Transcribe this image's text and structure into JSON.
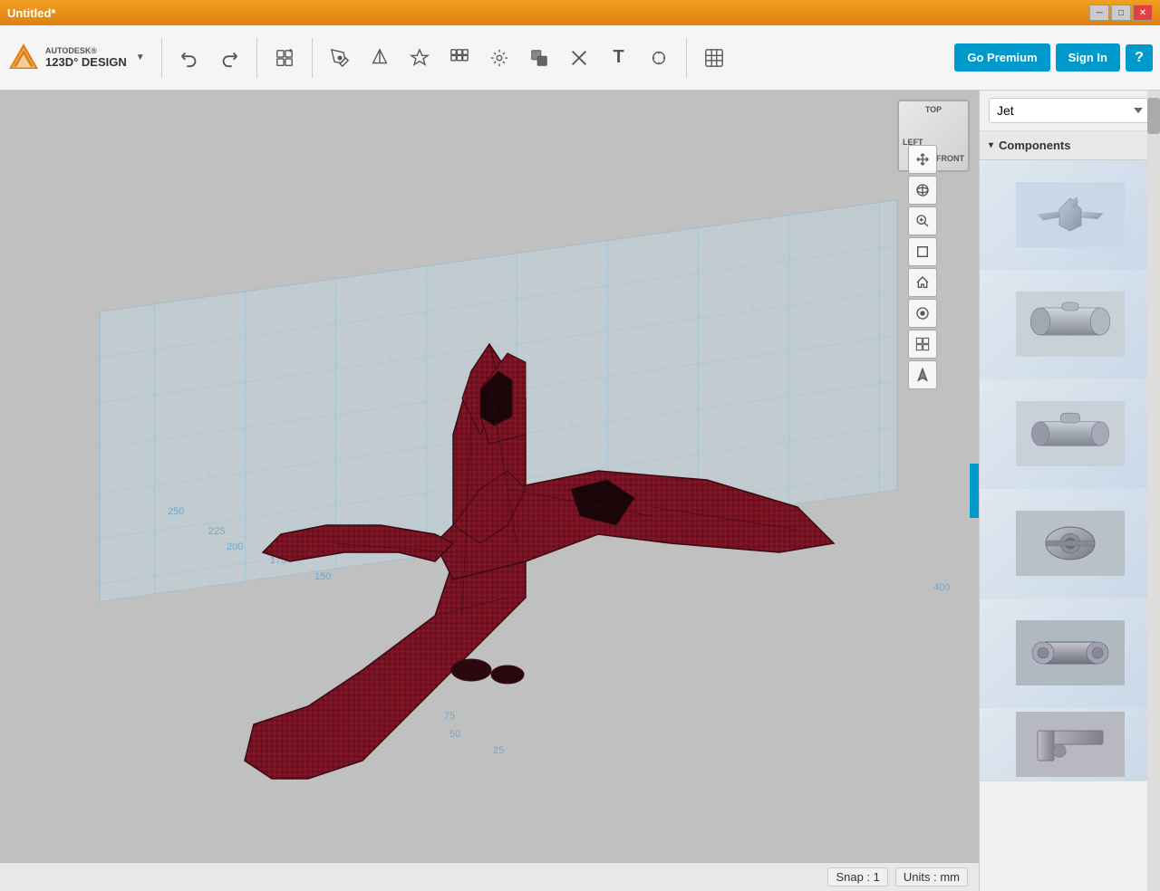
{
  "titleBar": {
    "title": "Untitled*",
    "controls": {
      "minimize": "─",
      "maximize": "□",
      "close": "✕"
    }
  },
  "toolbar": {
    "logo": {
      "autodesk": "AUTODESK®",
      "product": "123D° DESIGN",
      "dropdownLabel": "▼"
    },
    "tools": [
      {
        "name": "undo",
        "label": "↩",
        "title": "Undo"
      },
      {
        "name": "redo",
        "label": "↪",
        "title": "Redo"
      },
      {
        "name": "new-shape",
        "label": "⊞",
        "title": "New Shape"
      },
      {
        "name": "sketch",
        "label": "✎",
        "title": "Sketch"
      },
      {
        "name": "construct",
        "label": "⬡",
        "title": "Construct"
      },
      {
        "name": "modify",
        "label": "⟳",
        "title": "Modify"
      },
      {
        "name": "pattern",
        "label": "⊞",
        "title": "Pattern"
      },
      {
        "name": "transform",
        "label": "↻",
        "title": "Transform"
      },
      {
        "name": "combine",
        "label": "⬛",
        "title": "Combine"
      },
      {
        "name": "delete",
        "label": "✕",
        "title": "Delete"
      },
      {
        "name": "text",
        "label": "T",
        "title": "Text"
      },
      {
        "name": "measure",
        "label": "◯",
        "title": "Measure"
      },
      {
        "name": "snap-grid",
        "label": "⊞",
        "title": "Snap/Grid"
      }
    ],
    "rightButtons": {
      "premium": "Go Premium",
      "signin": "Sign In",
      "help": "?"
    }
  },
  "viewport": {
    "navCube": {
      "top": "TOP",
      "left": "LEFT",
      "front": "FRONT"
    },
    "viewControls": [
      {
        "name": "pan",
        "icon": "+",
        "title": "Pan"
      },
      {
        "name": "orbit",
        "icon": "↻",
        "title": "Orbit"
      },
      {
        "name": "zoom",
        "icon": "🔍",
        "title": "Zoom"
      },
      {
        "name": "fit",
        "icon": "⊡",
        "title": "Fit"
      },
      {
        "name": "home",
        "icon": "⌂",
        "title": "Home View"
      },
      {
        "name": "perspective",
        "icon": "◉",
        "title": "Perspective"
      },
      {
        "name": "display-mode",
        "icon": "⊞",
        "title": "Display Mode"
      },
      {
        "name": "render",
        "icon": "◈",
        "title": "Render"
      }
    ],
    "statusBar": {
      "snap": "Snap : 1",
      "units": "Units : mm"
    },
    "gridNumbers": [
      {
        "val": "250",
        "x": "170",
        "y": "460"
      },
      {
        "val": "225",
        "x": "215",
        "y": "482"
      },
      {
        "val": "200",
        "x": "225",
        "y": "500"
      },
      {
        "val": "175",
        "x": "280",
        "y": "518"
      },
      {
        "val": "150",
        "x": "330",
        "y": "540"
      },
      {
        "val": "75",
        "x": "430",
        "y": "688"
      },
      {
        "val": "50",
        "x": "480",
        "y": "710"
      },
      {
        "val": "25",
        "x": "528",
        "y": "730"
      },
      {
        "val": "400",
        "x": "1020",
        "y": "548"
      }
    ]
  },
  "rightPanel": {
    "dropdownLabel": "Jet",
    "componentsLabel": "Components",
    "items": [
      {
        "name": "jet-full",
        "desc": "Jet full model"
      },
      {
        "name": "engine-part-1",
        "desc": "Engine cylinder part 1"
      },
      {
        "name": "engine-part-2",
        "desc": "Engine cylinder part 2"
      },
      {
        "name": "engine-part-3",
        "desc": "Engine bolt part"
      },
      {
        "name": "engine-part-4",
        "desc": "Engine connector part"
      },
      {
        "name": "engine-part-5",
        "desc": "Engine small part"
      }
    ]
  }
}
